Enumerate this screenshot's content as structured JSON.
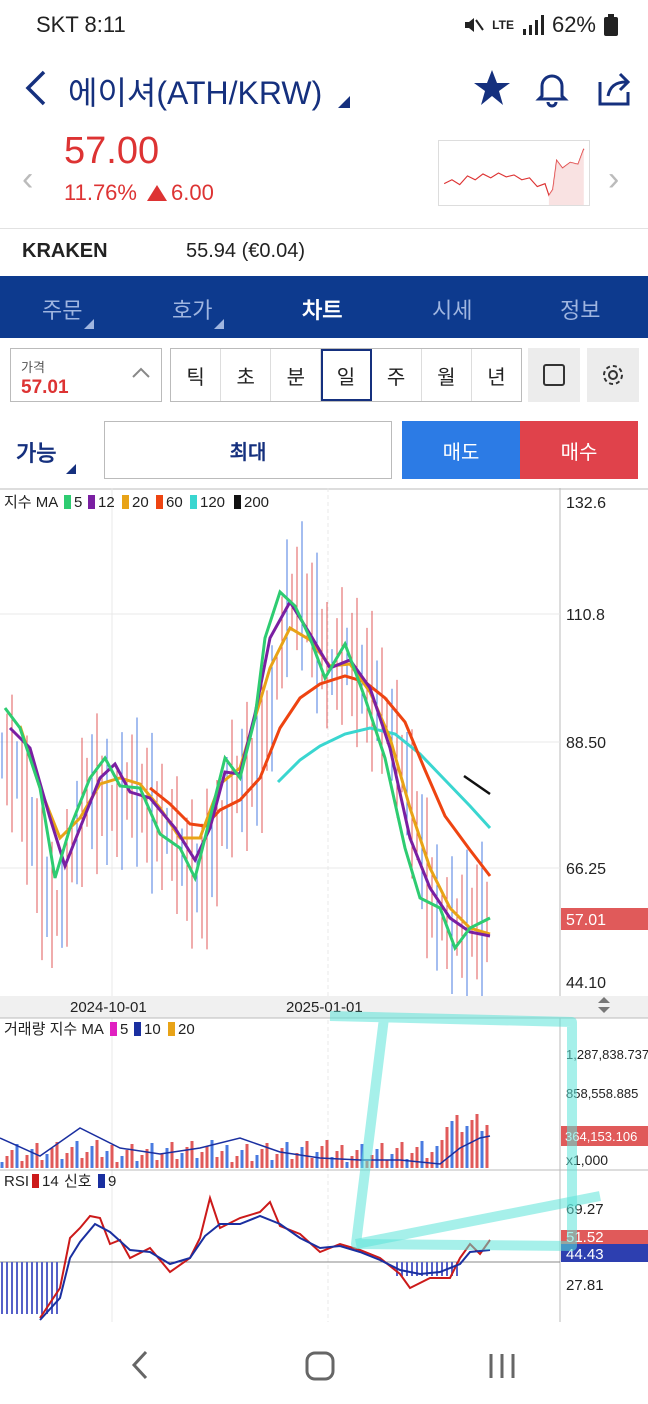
{
  "status": {
    "carrier_time": "SKT 8:11",
    "network": "LTE",
    "battery": "62%"
  },
  "header": {
    "title": "에이셔(ATH/KRW)"
  },
  "quote": {
    "price": "57.00",
    "change_pct": "11.76%",
    "change_abs": "6.00"
  },
  "exchange": {
    "name": "KRAKEN",
    "value": "55.94 (€0.04)"
  },
  "tabs": [
    {
      "label": "주문",
      "has_sub": true
    },
    {
      "label": "호가",
      "has_sub": true
    },
    {
      "label": "차트",
      "has_sub": false,
      "active": true
    },
    {
      "label": "시세",
      "has_sub": false
    },
    {
      "label": "정보",
      "has_sub": false
    }
  ],
  "price_input": {
    "label": "가격",
    "value": "57.01"
  },
  "periods": [
    "틱",
    "초",
    "분",
    "일",
    "주",
    "월",
    "년"
  ],
  "active_period": "일",
  "order": {
    "avail_label": "가능",
    "max_label": "최대",
    "sell_label": "매도",
    "buy_label": "매수"
  },
  "colors": {
    "up": "#d33333",
    "navy": "#15307e",
    "tab_bg": "#0d3a8e",
    "sell": "#2c7be5",
    "buy": "#e0424b",
    "ma5": "#2ecc71",
    "ma12": "#7a1fa2",
    "ma20": "#e8a317",
    "ma60": "#ee4411",
    "ma120": "#3ad6d0",
    "ma200": "#111111"
  },
  "chart": {
    "price_legend": {
      "prefix": "지수 MA",
      "items": [
        {
          "n": "5",
          "color": "#2ecc71"
        },
        {
          "n": "12",
          "color": "#7a1fa2"
        },
        {
          "n": "20",
          "color": "#e8a317"
        },
        {
          "n": "60",
          "color": "#ee4411"
        },
        {
          "n": "120",
          "color": "#3ad6d0"
        },
        {
          "n": "200",
          "color": "#111111"
        }
      ]
    },
    "price_axis": [
      "132.6",
      "110.8",
      "88.50",
      "66.25",
      "44.10"
    ],
    "current_price_tag": "57.01",
    "dates": [
      "2024-10-01",
      "2025-01-01"
    ],
    "volume_legend": {
      "prefix": "거래량 지수 MA",
      "items": [
        {
          "n": "5",
          "color": "#e020c0"
        },
        {
          "n": "10",
          "color": "#1a2fa0"
        },
        {
          "n": "20",
          "color": "#e8a317"
        }
      ]
    },
    "volume_axis": [
      "1,287,838.737",
      "858,558.885"
    ],
    "volume_tag": "364,153.106",
    "volume_unit": "x1,000",
    "rsi_legend": {
      "prefix": "RSI",
      "period": "14",
      "signal_label": "신호",
      "signal_period": "9"
    },
    "rsi_axis": [
      "69.27",
      "27.81"
    ],
    "rsi_tags": [
      "51.52",
      "44.43"
    ]
  },
  "chart_data": {
    "type": "line",
    "price_ylim": [
      44.1,
      132.6
    ],
    "close_ma5": [
      86,
      84,
      74,
      62,
      58,
      70,
      80,
      79,
      76,
      81,
      78,
      74,
      72,
      66,
      64,
      70,
      80,
      82,
      84,
      95,
      112,
      114,
      108,
      100,
      104,
      100,
      97,
      92,
      85,
      75,
      62,
      57,
      56,
      57,
      57
    ]
  }
}
